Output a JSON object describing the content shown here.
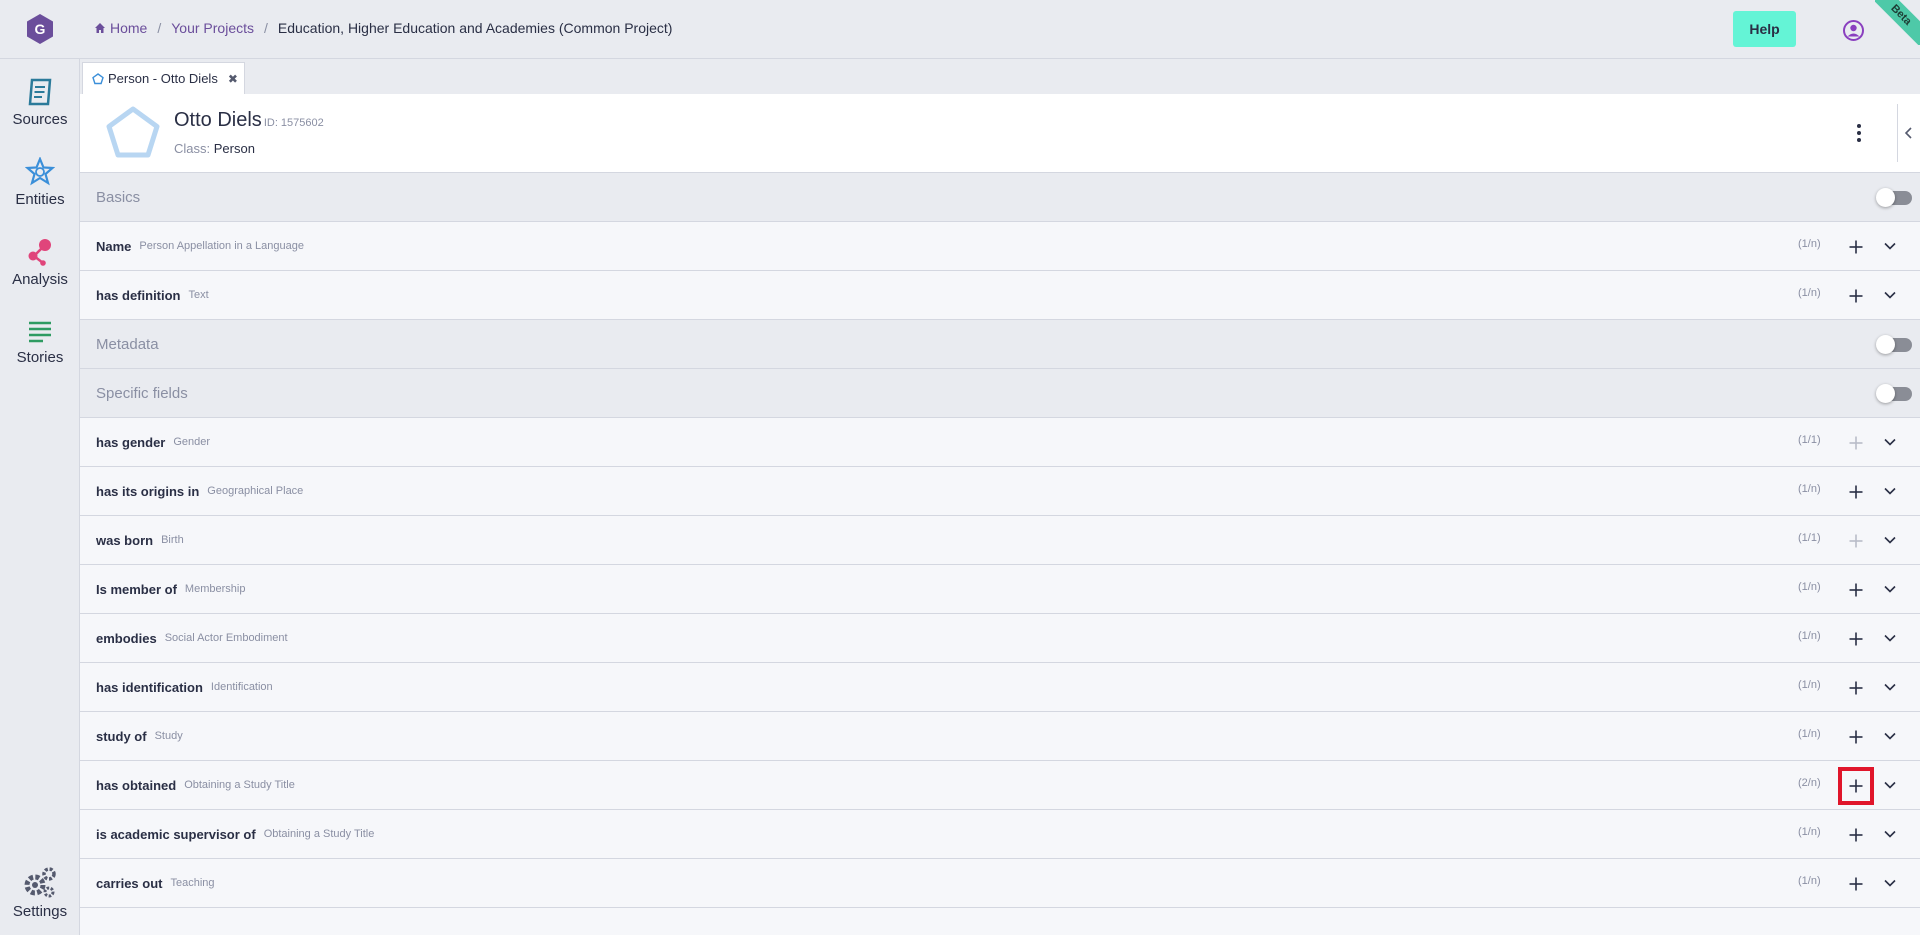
{
  "topbar": {
    "breadcrumb": [
      {
        "label": "Home",
        "icon": "home-icon"
      },
      {
        "label": "Your Projects"
      },
      {
        "label": "Education, Higher Education and Academies (Common Project)"
      }
    ],
    "help_label": "Help",
    "beta_label": "Beta"
  },
  "sidebar": {
    "items": [
      {
        "label": "Sources",
        "icon": "sources-icon",
        "color": "#2b7a9a"
      },
      {
        "label": "Entities",
        "icon": "entities-icon",
        "color": "#3b8fd9"
      },
      {
        "label": "Analysis",
        "icon": "analysis-icon",
        "color": "#e0457b"
      },
      {
        "label": "Stories",
        "icon": "stories-icon",
        "color": "#2e9b62"
      },
      {
        "label": "Settings",
        "icon": "settings-icon",
        "color": "#555a6e"
      }
    ]
  },
  "tab": {
    "label": "Person - Otto Diels",
    "close": "✖"
  },
  "entity": {
    "name": "Otto Diels",
    "id_label": "ID: 1575602",
    "class_prefix": "Class:",
    "class_value": "Person"
  },
  "rows": [
    {
      "kind": "section",
      "label": "Basics"
    },
    {
      "kind": "field",
      "label": "Name",
      "type": "Person Appellation in a Language",
      "quantity": "(1/n)",
      "add_enabled": true
    },
    {
      "kind": "field",
      "label": "has definition",
      "type": "Text",
      "quantity": "(1/n)",
      "add_enabled": true
    },
    {
      "kind": "section",
      "label": "Metadata"
    },
    {
      "kind": "section",
      "label": "Specific fields"
    },
    {
      "kind": "field",
      "label": "has gender",
      "type": "Gender",
      "quantity": "(1/1)",
      "add_enabled": false
    },
    {
      "kind": "field",
      "label": "has its origins in",
      "type": "Geographical Place",
      "quantity": "(1/n)",
      "add_enabled": true
    },
    {
      "kind": "field",
      "label": "was born",
      "type": "Birth",
      "quantity": "(1/1)",
      "add_enabled": false
    },
    {
      "kind": "field",
      "label": "Is member of",
      "type": "Membership",
      "quantity": "(1/n)",
      "add_enabled": true
    },
    {
      "kind": "field",
      "label": "embodies",
      "type": "Social Actor Embodiment",
      "quantity": "(1/n)",
      "add_enabled": true
    },
    {
      "kind": "field",
      "label": "has identification",
      "type": "Identification",
      "quantity": "(1/n)",
      "add_enabled": true
    },
    {
      "kind": "field",
      "label": "study of",
      "type": "Study",
      "quantity": "(1/n)",
      "add_enabled": true
    },
    {
      "kind": "field",
      "label": "has obtained",
      "type": "Obtaining a Study Title",
      "quantity": "(2/n)",
      "add_enabled": true
    },
    {
      "kind": "field",
      "label": "is academic supervisor of",
      "type": "Obtaining a Study Title",
      "quantity": "(1/n)",
      "add_enabled": true
    },
    {
      "kind": "field",
      "label": "carries out",
      "type": "Teaching",
      "quantity": "(1/n)",
      "add_enabled": true
    }
  ],
  "colors": {
    "accent": "#6b4e9b",
    "help_bg": "#64f4d6",
    "highlight": "#e0152a"
  }
}
